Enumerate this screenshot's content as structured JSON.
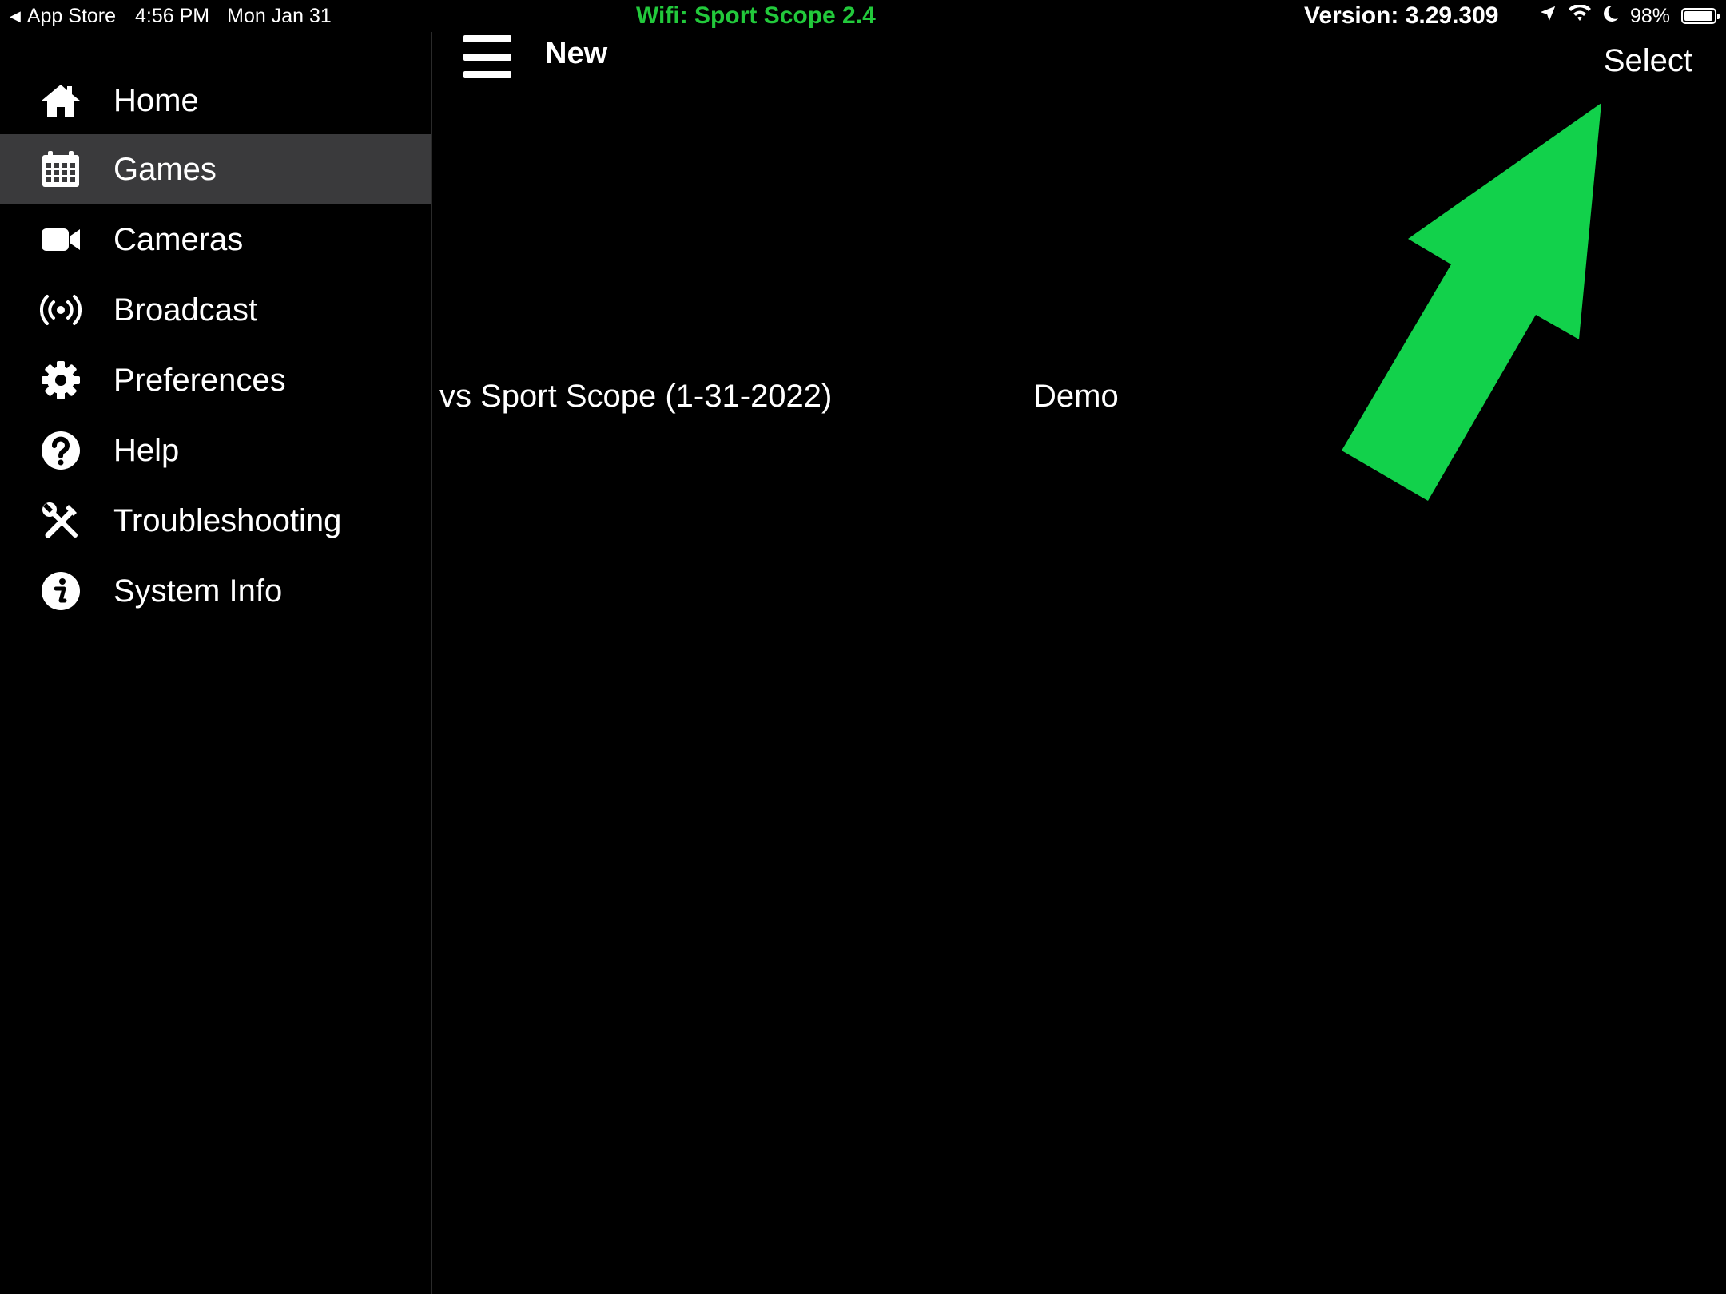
{
  "status_bar": {
    "back_label": "App Store",
    "time": "4:56 PM",
    "date": "Mon Jan 31",
    "battery_text": "98%",
    "battery_level": 0.98
  },
  "wifi_banner": "Wifi: Sport Scope 2.4",
  "version_label": "Version: 3.29.309",
  "sidebar": {
    "items": [
      {
        "label": "Home",
        "icon": "home-icon"
      },
      {
        "label": "Games",
        "icon": "calendar-icon",
        "active": true
      },
      {
        "label": "Cameras",
        "icon": "video-camera-icon"
      },
      {
        "label": "Broadcast",
        "icon": "broadcast-icon"
      },
      {
        "label": "Preferences",
        "icon": "gear-icon"
      },
      {
        "label": "Help",
        "icon": "help-icon"
      },
      {
        "label": "Troubleshooting",
        "icon": "tools-icon"
      },
      {
        "label": "System Info",
        "icon": "info-icon"
      }
    ]
  },
  "toolbar": {
    "new_label": "New",
    "select_label": "Select"
  },
  "games": [
    {
      "title": "vs Sport Scope (1-31-2022)",
      "type": "Demo"
    }
  ],
  "colors": {
    "background": "#000000",
    "sidebar_active": "#3a3a3c",
    "wifi_green": "#22c93b",
    "arrow_green": "#12d14b"
  }
}
